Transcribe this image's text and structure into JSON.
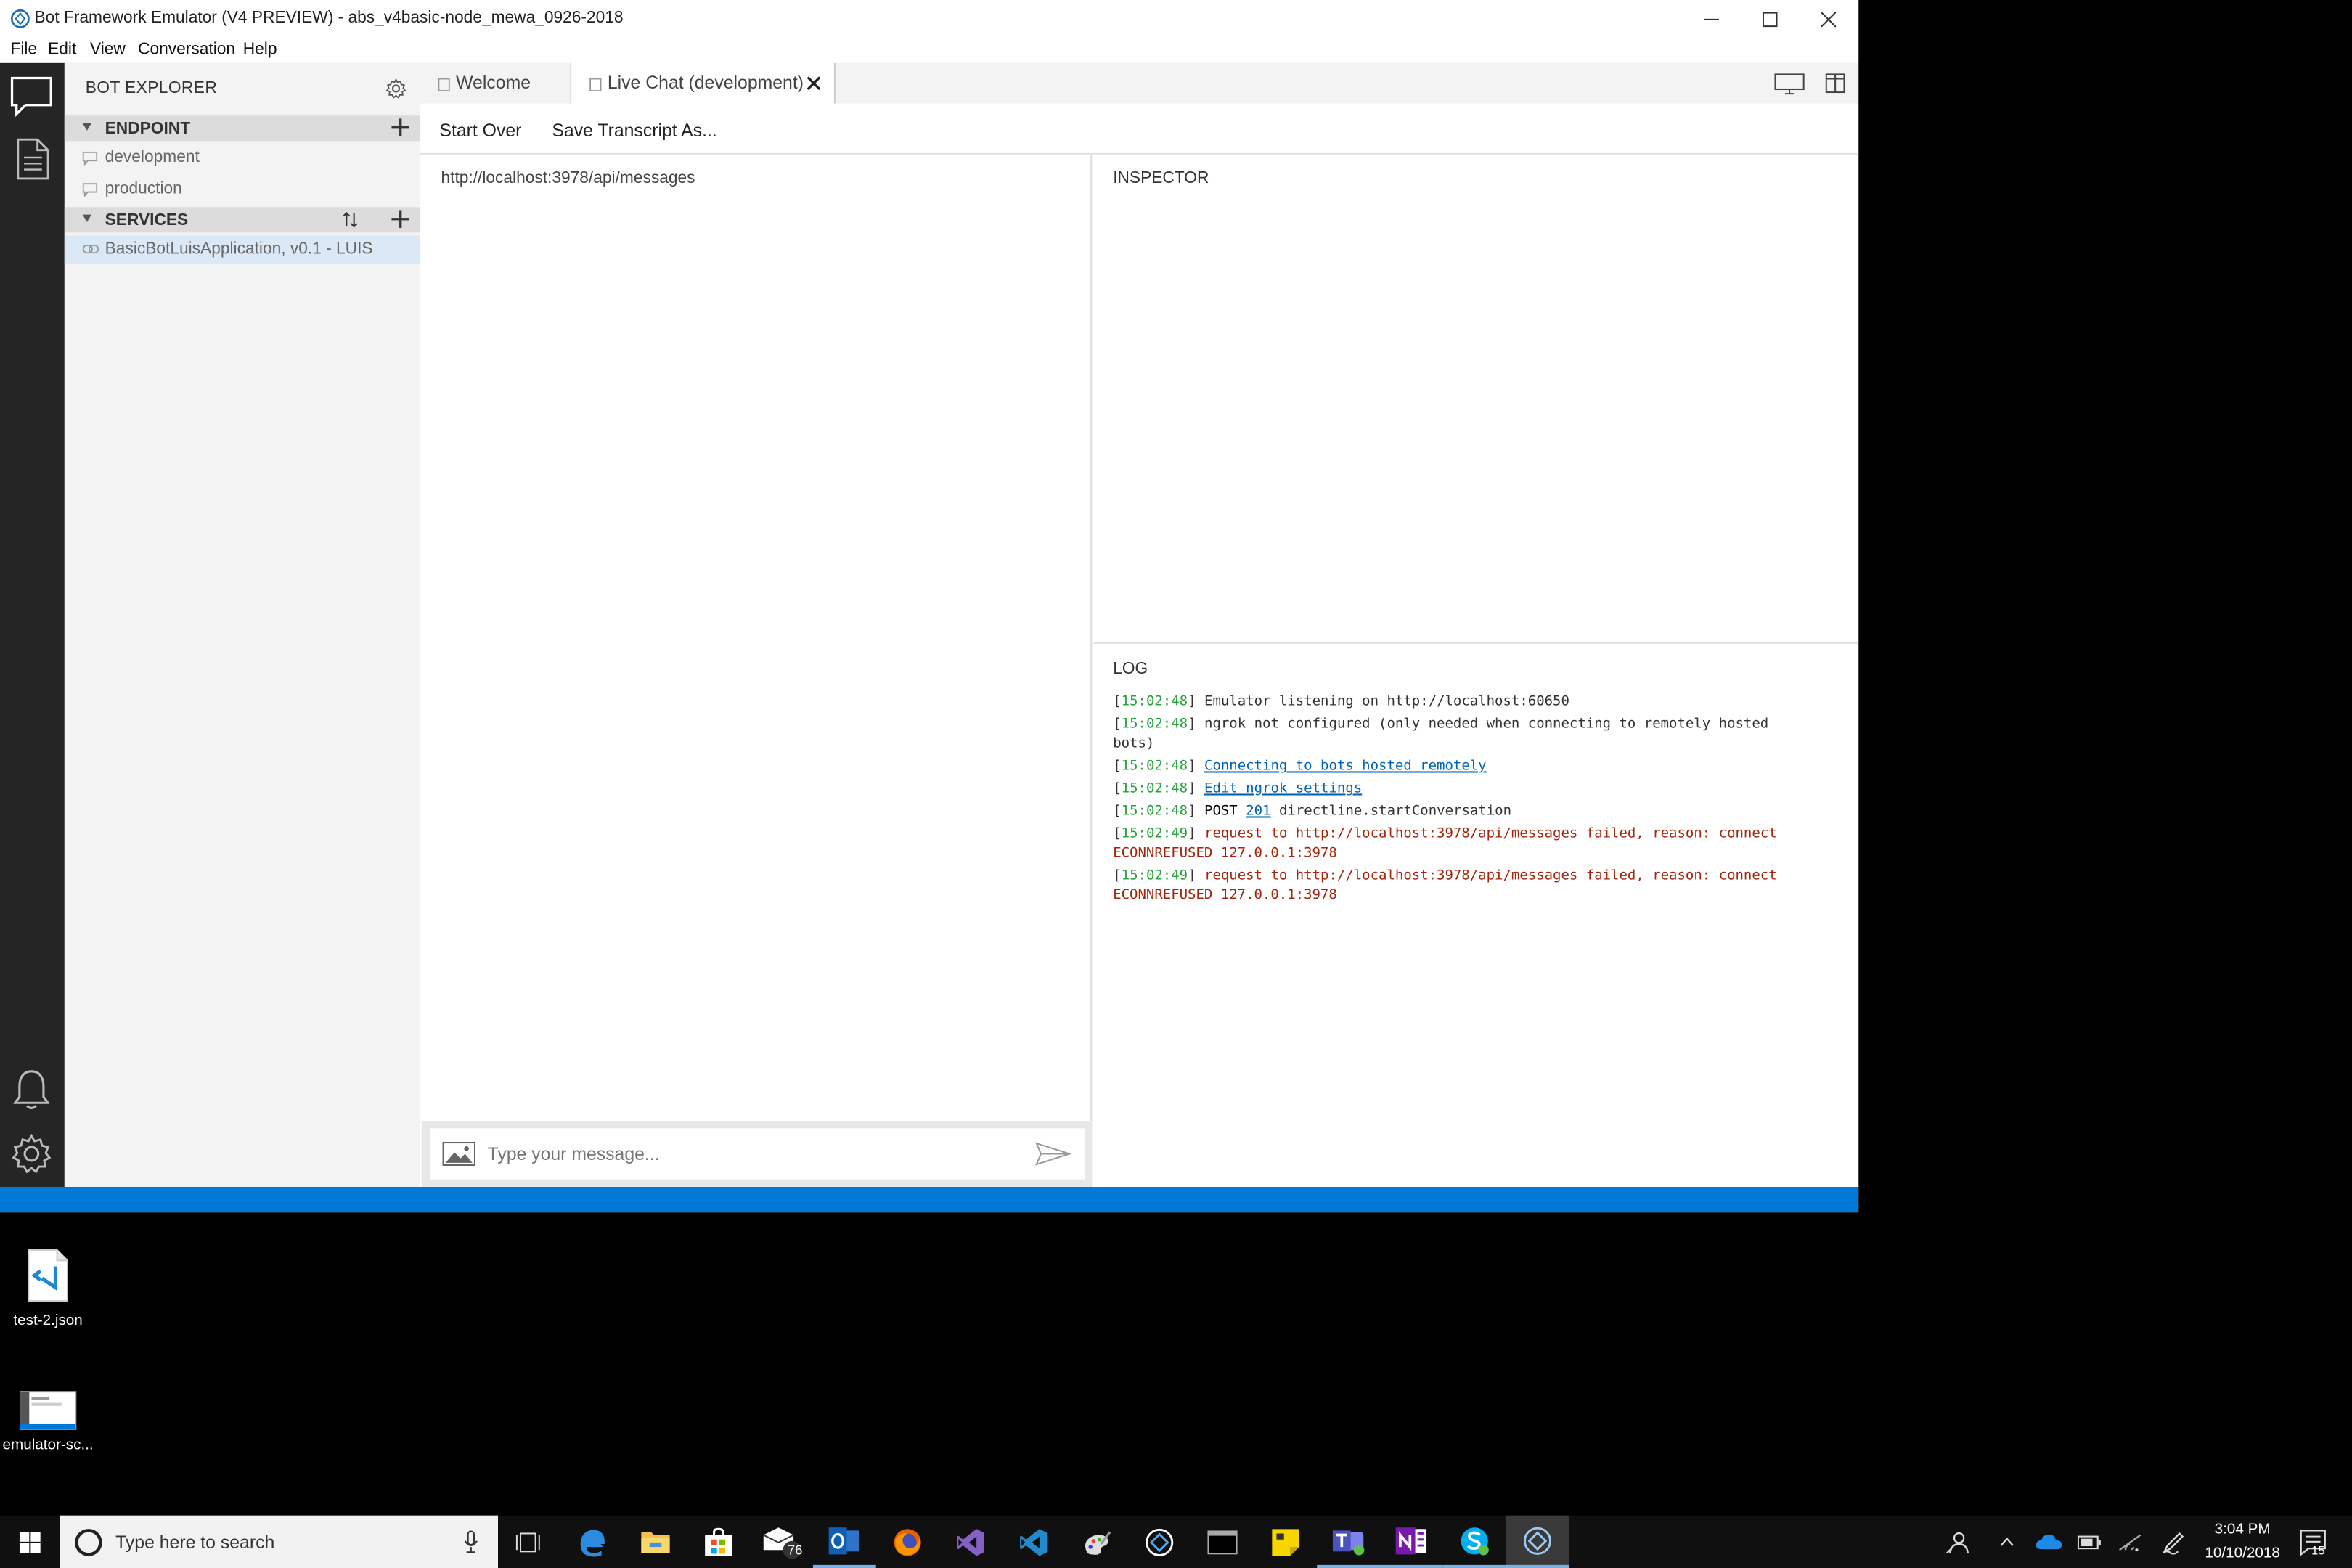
{
  "window": {
    "title": "Bot Framework Emulator (V4 PREVIEW) - abs_v4basic-node_mewa_0926-2018"
  },
  "menu": [
    "File",
    "Edit",
    "View",
    "Conversation",
    "Help"
  ],
  "explorer": {
    "title": "BOT EXPLORER",
    "endpoint_label": "ENDPOINT",
    "endpoints": [
      "development",
      "production"
    ],
    "services_label": "SERVICES",
    "services": [
      "BasicBotLuisApplication, v0.1 - LUIS"
    ]
  },
  "tabs": [
    {
      "label": "Welcome"
    },
    {
      "label": "Live Chat (development)"
    }
  ],
  "toolbar": {
    "start_over": "Start Over",
    "save_transcript": "Save Transcript As..."
  },
  "chat": {
    "url": "http://localhost:3978/api/messages",
    "placeholder": "Type your message..."
  },
  "inspector": {
    "title": "INSPECTOR"
  },
  "log": {
    "title": "LOG",
    "lines": [
      {
        "ts": "15:02:48",
        "text": "Emulator listening on http://localhost:60650"
      },
      {
        "ts": "15:02:48",
        "text": "ngrok not configured (only needed when connecting to remotely hosted bots)"
      },
      {
        "ts": "15:02:48",
        "link": "Connecting to bots hosted remotely"
      },
      {
        "ts": "15:02:48",
        "link": "Edit ngrok settings"
      },
      {
        "ts": "15:02:48",
        "method": "POST",
        "status": "201",
        "text": "directline.startConversation"
      },
      {
        "ts": "15:02:49",
        "error": "request to http://localhost:3978/api/messages failed, reason: connect ECONNREFUSED 127.0.0.1:3978"
      },
      {
        "ts": "15:02:49",
        "error": "request to http://localhost:3978/api/messages failed, reason: connect ECONNREFUSED 127.0.0.1:3978"
      }
    ]
  },
  "desktop": {
    "icons": [
      {
        "label": "test-2.json"
      },
      {
        "label": "emulator-sc..."
      }
    ]
  },
  "taskbar": {
    "search_placeholder": "Type here to search",
    "mail_badge": "76",
    "time": "3:04 PM",
    "date": "10/10/2018",
    "notification_count": "15"
  },
  "colors": {
    "accent": "#0078d7",
    "activity_bar": "#252526",
    "timestamp": "#2aa33f",
    "error": "#a1260d",
    "link": "#0063b1"
  }
}
